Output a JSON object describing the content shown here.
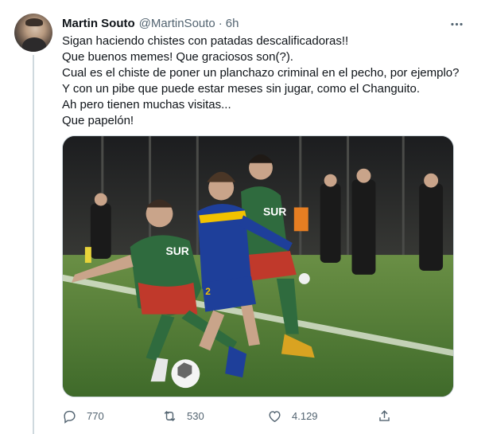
{
  "tweet": {
    "author": {
      "display_name": "Martin Souto",
      "handle": "@MartinSouto",
      "separator": "·",
      "time": "6h"
    },
    "text_lines": [
      "Sigan haciendo chistes con patadas descalificadoras!!",
      "Que buenos memes! Que graciosos son(?).",
      "Cual es el chiste de poner un planchazo criminal en el pecho, por ejemplo?",
      "Y con un pibe que puede estar meses sin jugar, como el Changuito.",
      "Ah pero tienen muchas visitas...",
      "Que papelón!"
    ],
    "media": {
      "shirt_text": "SUR",
      "left_player_number": "2"
    },
    "actions": {
      "reply_count": "770",
      "retweet_count": "530",
      "like_count": "4.129"
    },
    "icons": [
      "more-icon",
      "reply-icon",
      "retweet-icon",
      "like-icon",
      "share-icon"
    ],
    "colors": {
      "text_primary": "#0f1419",
      "text_secondary": "#536471",
      "border": "#cfd9de",
      "boca_blue": "#1e3f9a",
      "boca_yellow": "#f2c200",
      "rival_green": "#2f6b3e",
      "rival_red": "#c0392b",
      "pitch_green": "#4f7d34"
    }
  }
}
